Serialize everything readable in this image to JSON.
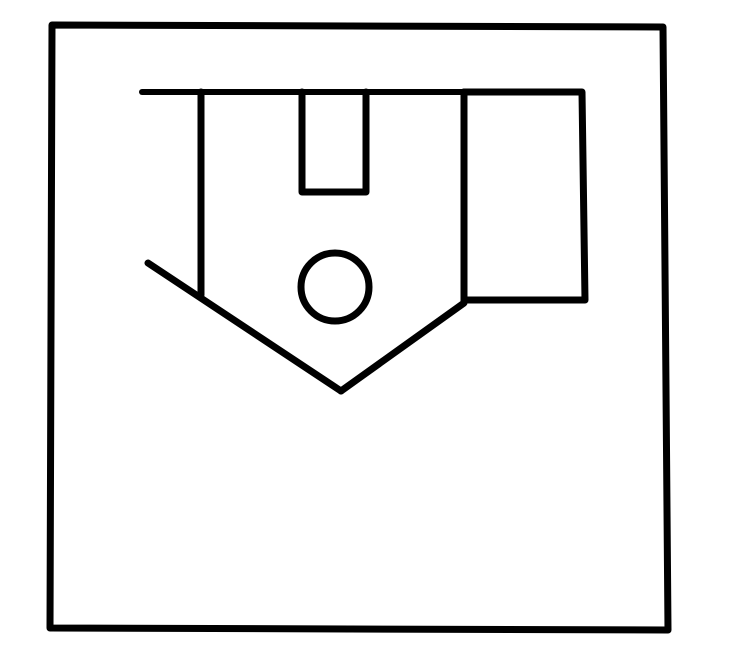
{
  "diagram": {
    "kind": "line-drawing",
    "colors": {
      "background": "#ffffff",
      "ink": "#000000"
    },
    "shapes": [
      "outer-square-border",
      "top-horizontal-line",
      "left-vertical-line",
      "left-diagonal-line",
      "right-diagonal-line",
      "top-slot-rectangle",
      "center-circle",
      "right-rectangle"
    ]
  }
}
